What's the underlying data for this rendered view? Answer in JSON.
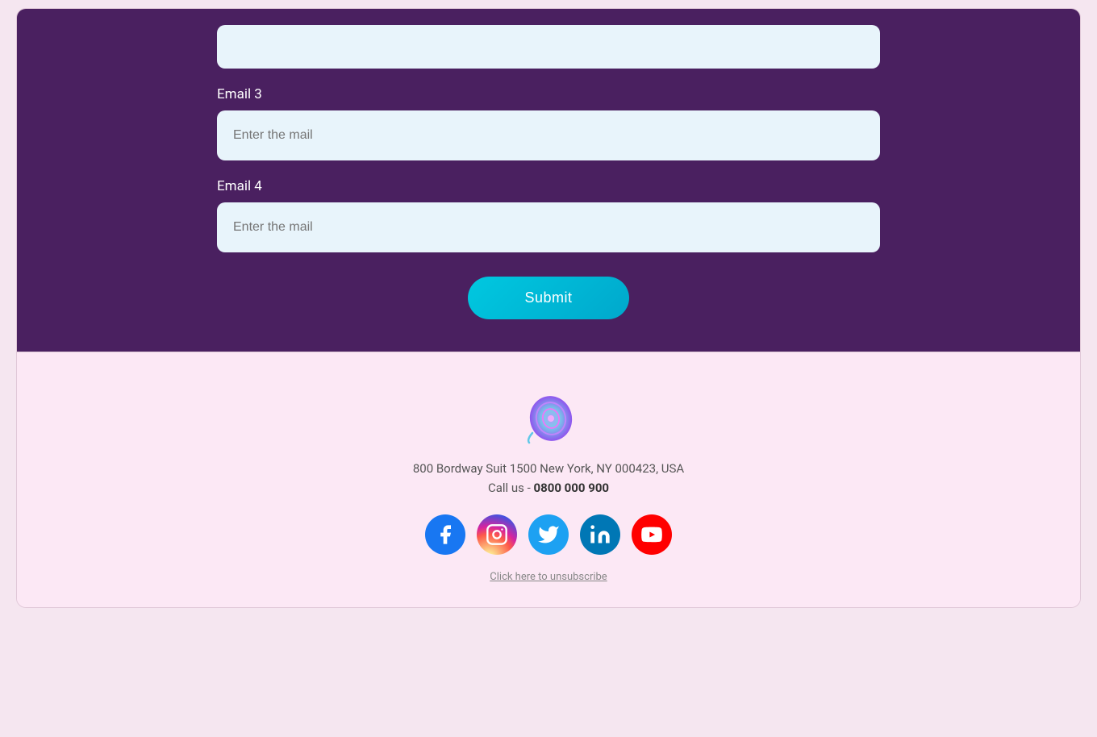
{
  "form": {
    "email3_label": "Email 3",
    "email4_label": "Email 4",
    "email3_placeholder": "Enter the mail",
    "email4_placeholder": "Enter the mail",
    "submit_label": "Submit"
  },
  "footer": {
    "address": "800 Bordway Suit 1500 New York, NY 000423, USA",
    "call_prefix": "Call us - ",
    "phone": "0800 000 900",
    "unsubscribe_label": "Click here to unsubscribe"
  },
  "social": [
    {
      "name": "facebook",
      "class": "facebook"
    },
    {
      "name": "instagram",
      "class": "instagram"
    },
    {
      "name": "twitter",
      "class": "twitter"
    },
    {
      "name": "linkedin",
      "class": "linkedin"
    },
    {
      "name": "youtube",
      "class": "youtube"
    }
  ]
}
